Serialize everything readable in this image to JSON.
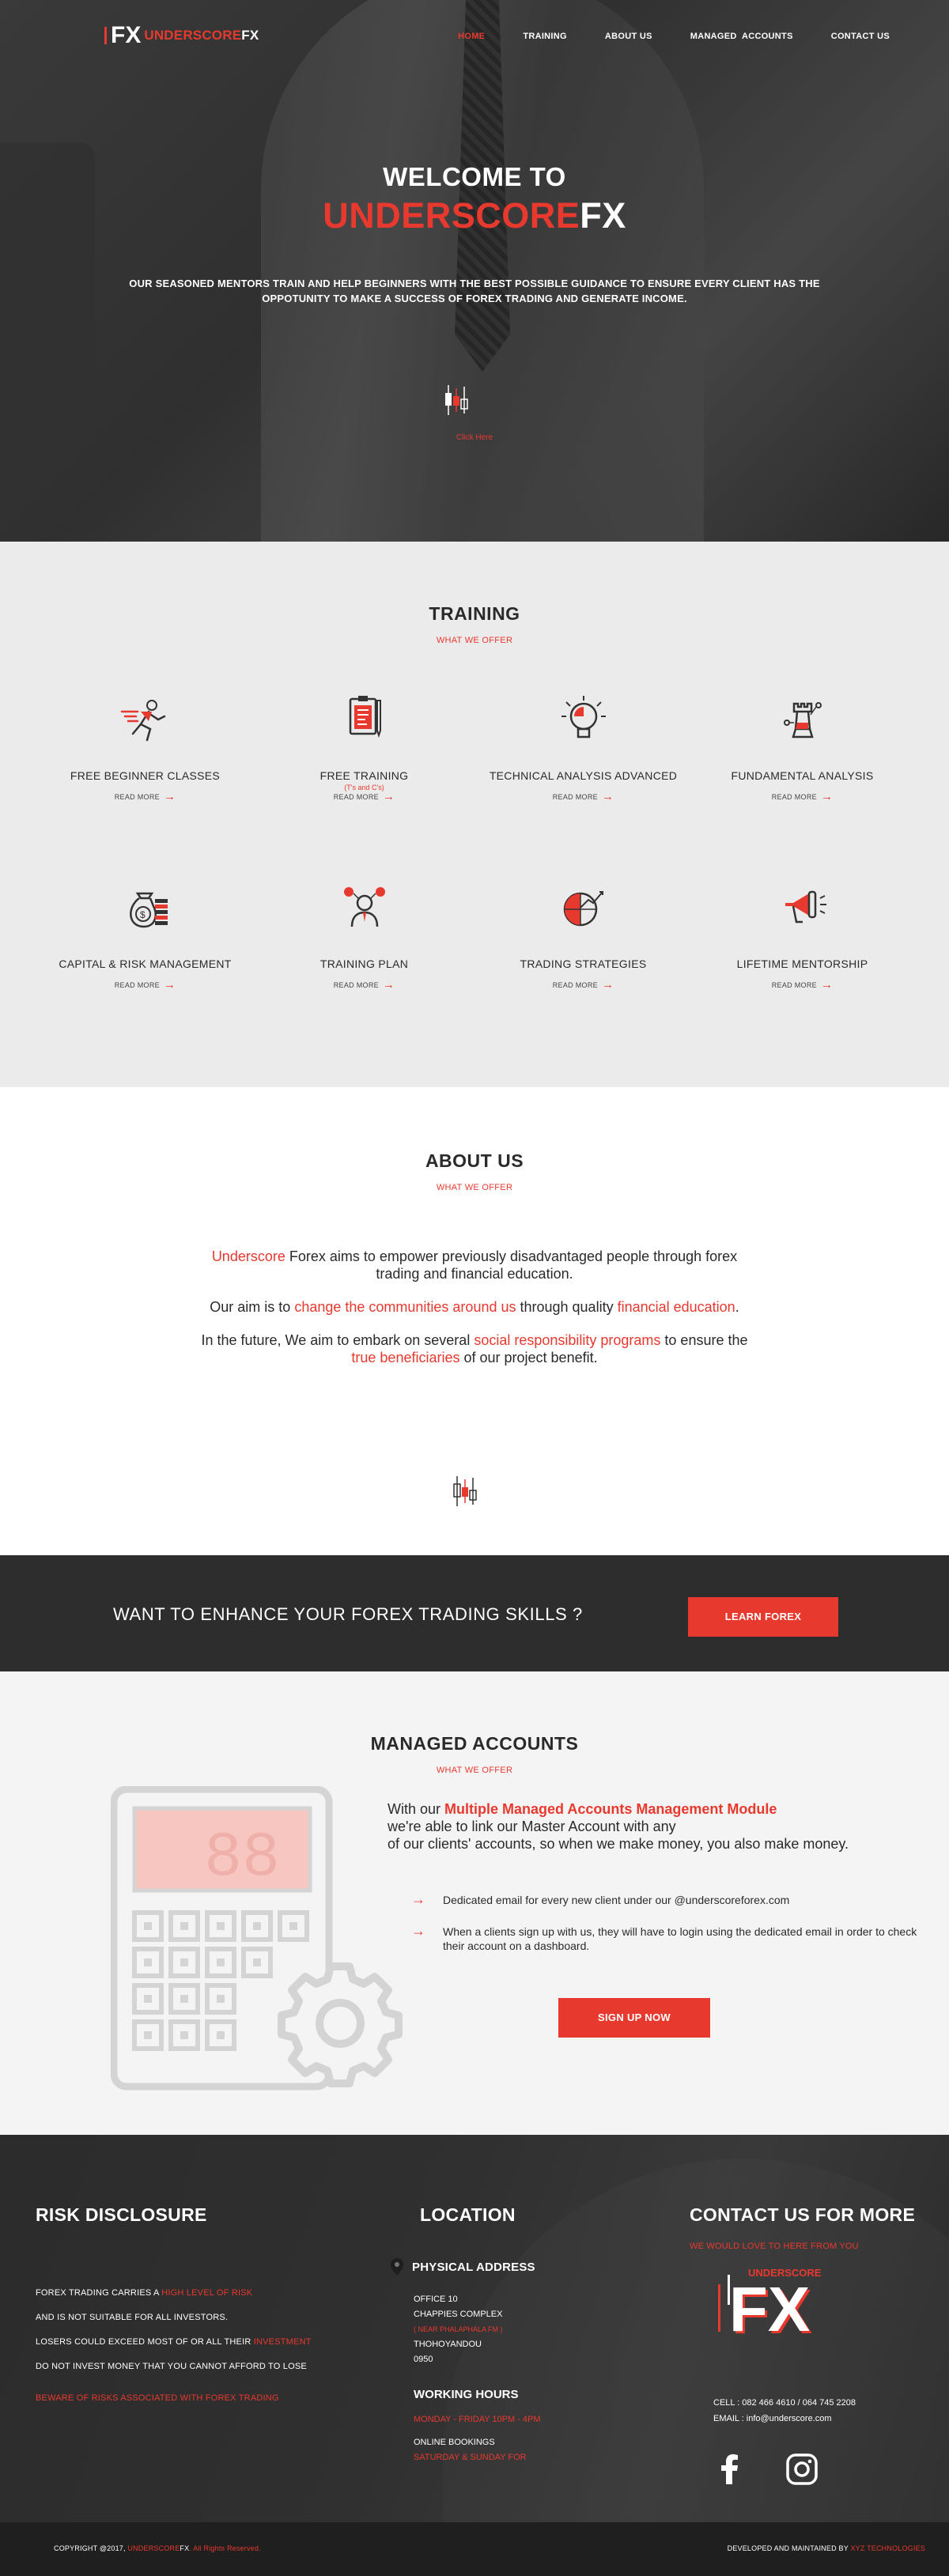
{
  "brand": {
    "mark": "FX",
    "name_red": "UNDERSCORE",
    "name_white": "FX",
    "accent": "#e8392f",
    "dark": "#2d2d2d"
  },
  "nav": {
    "items": [
      {
        "label": "HOME",
        "active": true
      },
      {
        "label": "TRAINING",
        "active": false
      },
      {
        "label": "ABOUT US",
        "active": false
      },
      {
        "label": "MANAGED  ACCOUNTS",
        "active": false
      },
      {
        "label": "CONTACT US",
        "active": false
      }
    ]
  },
  "hero": {
    "welcome": "WELCOME TO",
    "title_red": "UNDERSCORE",
    "title_white": "FX",
    "description": "OUR SEASONED MENTORS TRAIN AND HELP BEGINNERS WITH THE BEST POSSIBLE GUIDANCE TO ENSURE EVERY CLIENT HAS THE OPPOTUNITY TO MAKE A SUCCESS OF FOREX TRADING AND GENERATE INCOME.",
    "click_label": "Click Here",
    "icon": "candlestick-icon"
  },
  "training": {
    "title": "TRAINING",
    "subtitle": "WHAT WE OFFER",
    "read_more": "READ MORE",
    "cards": [
      {
        "title": "FREE BEGINNER CLASSES",
        "note": "",
        "icon": "running-man-icon"
      },
      {
        "title": "FREE TRAINING",
        "note": "(T's and C's)",
        "icon": "clipboard-icon"
      },
      {
        "title": "TECHNICAL ANALYSIS ADVANCED",
        "note": "",
        "icon": "lightbulb-icon"
      },
      {
        "title": "FUNDAMENTAL ANALYSIS",
        "note": "",
        "icon": "chess-rook-icon"
      },
      {
        "title": "CAPITAL & RISK MANAGEMENT",
        "note": "",
        "icon": "money-bag-icon"
      },
      {
        "title": "TRAINING PLAN",
        "note": "",
        "icon": "mentor-icon"
      },
      {
        "title": "TRADING STRATEGIES",
        "note": "",
        "icon": "globe-chart-icon"
      },
      {
        "title": "LIFETIME MENTORSHIP",
        "note": "",
        "icon": "megaphone-icon"
      }
    ]
  },
  "about": {
    "title": "ABOUT US",
    "subtitle": "WHAT WE OFFER",
    "p1_red": "Underscore",
    "p1_rest": " Forex aims to empower previously disadvantaged people through forex trading and financial education.",
    "p2_a": "Our aim is to ",
    "p2_red": "change the communities around us",
    "p2_b": " through quality ",
    "p2_red2": "financial education",
    "p2_c": ".",
    "p3_a": "In the future, We aim to embark on several ",
    "p3_red": "social responsibility programs",
    "p3_b": " to ensure the ",
    "p3_red2": "true beneficiaries",
    "p3_c": " of our project benefit."
  },
  "cta": {
    "question": "WANT TO ENHANCE YOUR FOREX TRADING SKILLS ?",
    "button": "LEARN FOREX"
  },
  "managed": {
    "title": "MANAGED ACCOUNTS",
    "subtitle": "WHAT WE OFFER",
    "intro_a": "With our ",
    "intro_red": "Multiple Managed Accounts Management Module",
    "intro_b": "we're able to link our Master Account with any",
    "intro_c": "of our clients' accounts, so when we make money, you also make money.",
    "bullets": [
      "Dedicated email for every new client under our @underscoreforex.com",
      "When a clients sign up with us, they will have to login using the dedicated email in order to check their account on a dashboard."
    ],
    "button": "SIGN UP NOW",
    "calc_display": "88"
  },
  "footer": {
    "risk": {
      "title": "RISK DISCLOSURE",
      "l1_a": "FOREX TRADING CARRIES A ",
      "l1_red": "HIGH LEVEL OF RISK",
      "l2": "AND IS NOT SUITABLE FOR ALL INVESTORS.",
      "l3_a": "LOSERS COULD EXCEED MOST OF OR ALL THEIR ",
      "l3_red": "INVESTMENT",
      "l4": "DO NOT INVEST MONEY THAT YOU CANNOT AFFORD TO LOSE",
      "warning": "BEWARE OF RISKS ASSOCIATED WITH FOREX TRADING"
    },
    "location": {
      "title": "LOCATION",
      "physical_title": "PHYSICAL ADDRESS",
      "address": [
        "OFFICE 10",
        "CHAPPIES COMPLEX"
      ],
      "address_red": "( NEAR PHALAPHALA FM )",
      "address2": [
        "THOHOYANDOU",
        "0950"
      ],
      "hours_title": "WORKING HOURS",
      "hours_red": "MONDAY - FRIDAY 10PM - 4PM",
      "online": "ONLINE BOOKINGS",
      "online_red": "SATURDAY & SUNDAY FOR"
    },
    "contact": {
      "title": "CONTACT US FOR MORE",
      "subtitle": "WE WOULD LOVE TO HERE FROM YOU",
      "cell": "CELL : 082 466 4610 / 064 745 2208",
      "email": "EMAIL : info@underscore.com",
      "logo_word": "UNDERSCORE",
      "logo_mark": "FX"
    }
  },
  "copyright": {
    "left_a": "COPYRIGHT @2017, ",
    "left_red": "UNDERSCORE",
    "left_b": "FX",
    "left_c": ". All Rights Reserved.",
    "right_a": "DEVELOPED AND MAINTAINED BY ",
    "right_red": "XYZ TECHNOLOGIES"
  }
}
